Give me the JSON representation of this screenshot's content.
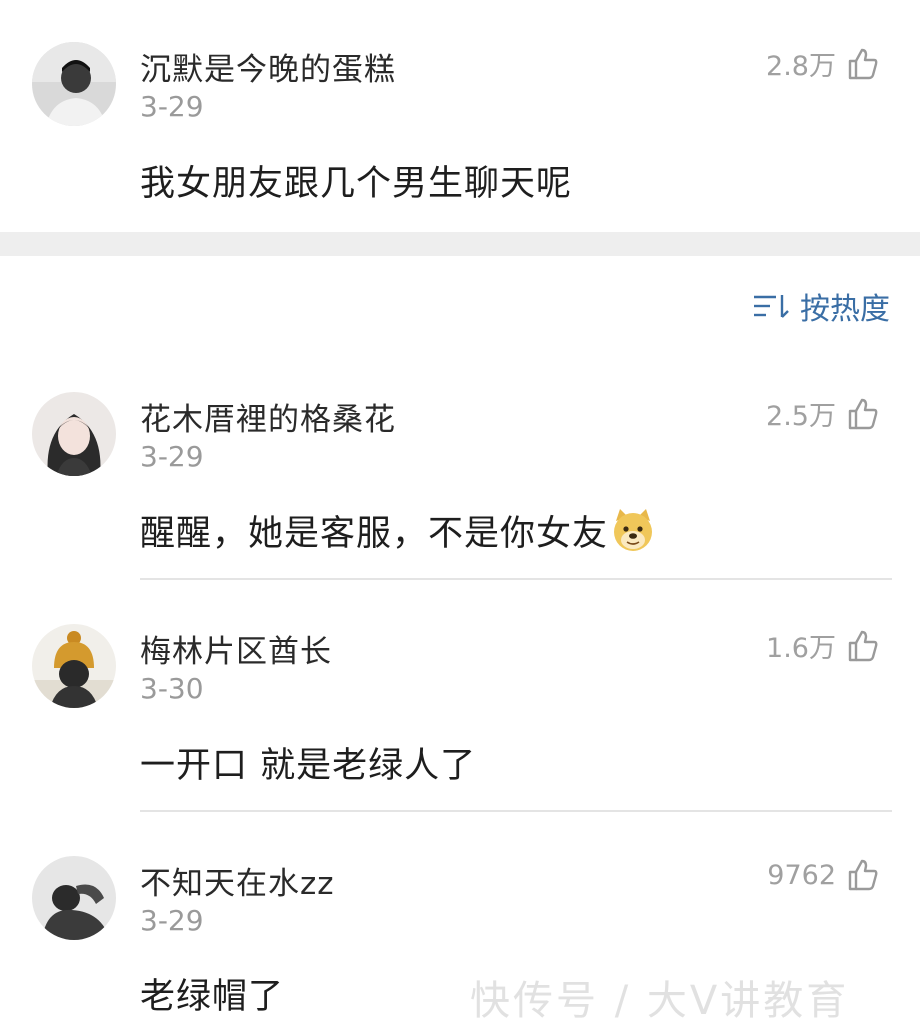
{
  "post": {
    "author": "沉默是今晚的蛋糕",
    "date": "3-29",
    "likes": "2.8万",
    "text": "我女朋友跟几个男生聊天呢"
  },
  "sort": {
    "label": "按热度",
    "icon": "sort-icon"
  },
  "comments": [
    {
      "author": "花木厝裡的格桑花",
      "date": "3-29",
      "likes": "2.5万",
      "text": "醒醒，她是客服，不是你女友",
      "emoji": "doge-emoji"
    },
    {
      "author": "梅林片区酋长",
      "date": "3-30",
      "likes": "1.6万",
      "text": "一开口 就是老绿人了"
    },
    {
      "author": "不知天在水zz",
      "date": "3-29",
      "likes": "9762",
      "text": "老绿帽了"
    }
  ],
  "watermark": "快传号 / 大V讲教育",
  "icons": {
    "like": "thumbs-up-icon"
  },
  "colors": {
    "accent": "#3a6ea5",
    "muted": "#9a9a9a",
    "band": "#eeeeee"
  }
}
